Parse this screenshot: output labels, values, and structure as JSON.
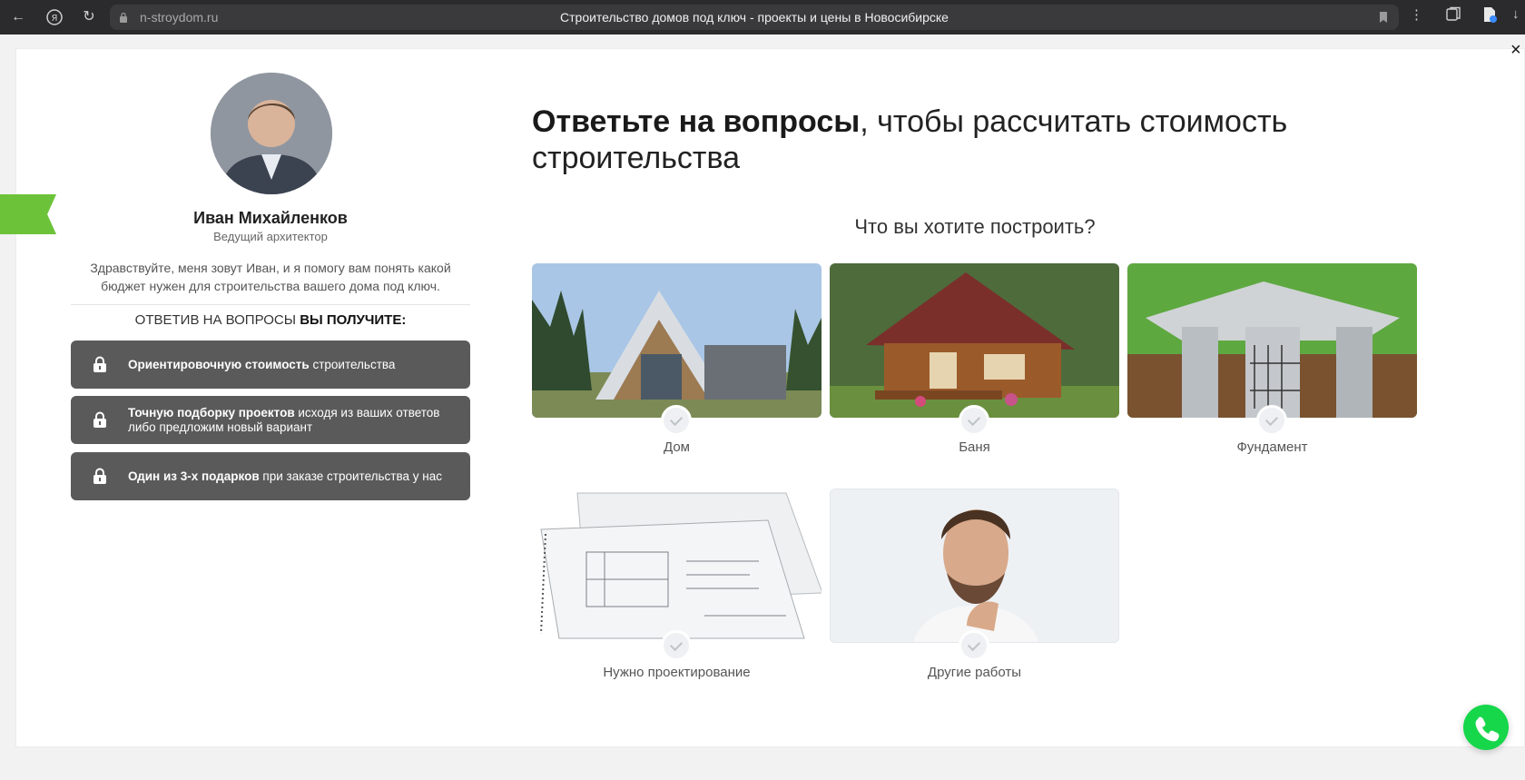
{
  "browser": {
    "url": "n-stroydom.ru",
    "title": "Строительство домов под ключ - проекты и цены в Новосибирске"
  },
  "consultant": {
    "name": "Иван Михайленков",
    "role": "Ведущий архитектор",
    "intro": "Здравствуйте, меня зовут Иван, и я помогу вам понять какой бюджет нужен для строительства вашего дома под ключ.",
    "receive_prefix": "ОТВЕТИВ НА ВОПРОСЫ ",
    "receive_bold": "ВЫ ПОЛУЧИТЕ:"
  },
  "benefits": [
    {
      "bold": "Ориентировочную стоимость",
      "rest": " строительства"
    },
    {
      "bold": "Точную подборку проектов",
      "rest": " исходя из ваших ответов либо предложим новый вариант"
    },
    {
      "bold": "Один из 3-х подарков",
      "rest": " при заказе строительства у нас"
    }
  ],
  "headline": {
    "bold": "Ответьте на вопросы",
    "rest": ", чтобы рассчитать стоимость строительства"
  },
  "question": "Что вы хотите построить?",
  "options": [
    {
      "label": "Дом"
    },
    {
      "label": "Баня"
    },
    {
      "label": "Фундамент"
    },
    {
      "label": "Нужно проектирование"
    },
    {
      "label": "Другие работы"
    }
  ],
  "colors": {
    "accent_green": "#6cc33a",
    "call_button": "#16d64a",
    "benefit_bg": "#5a5a5a"
  }
}
